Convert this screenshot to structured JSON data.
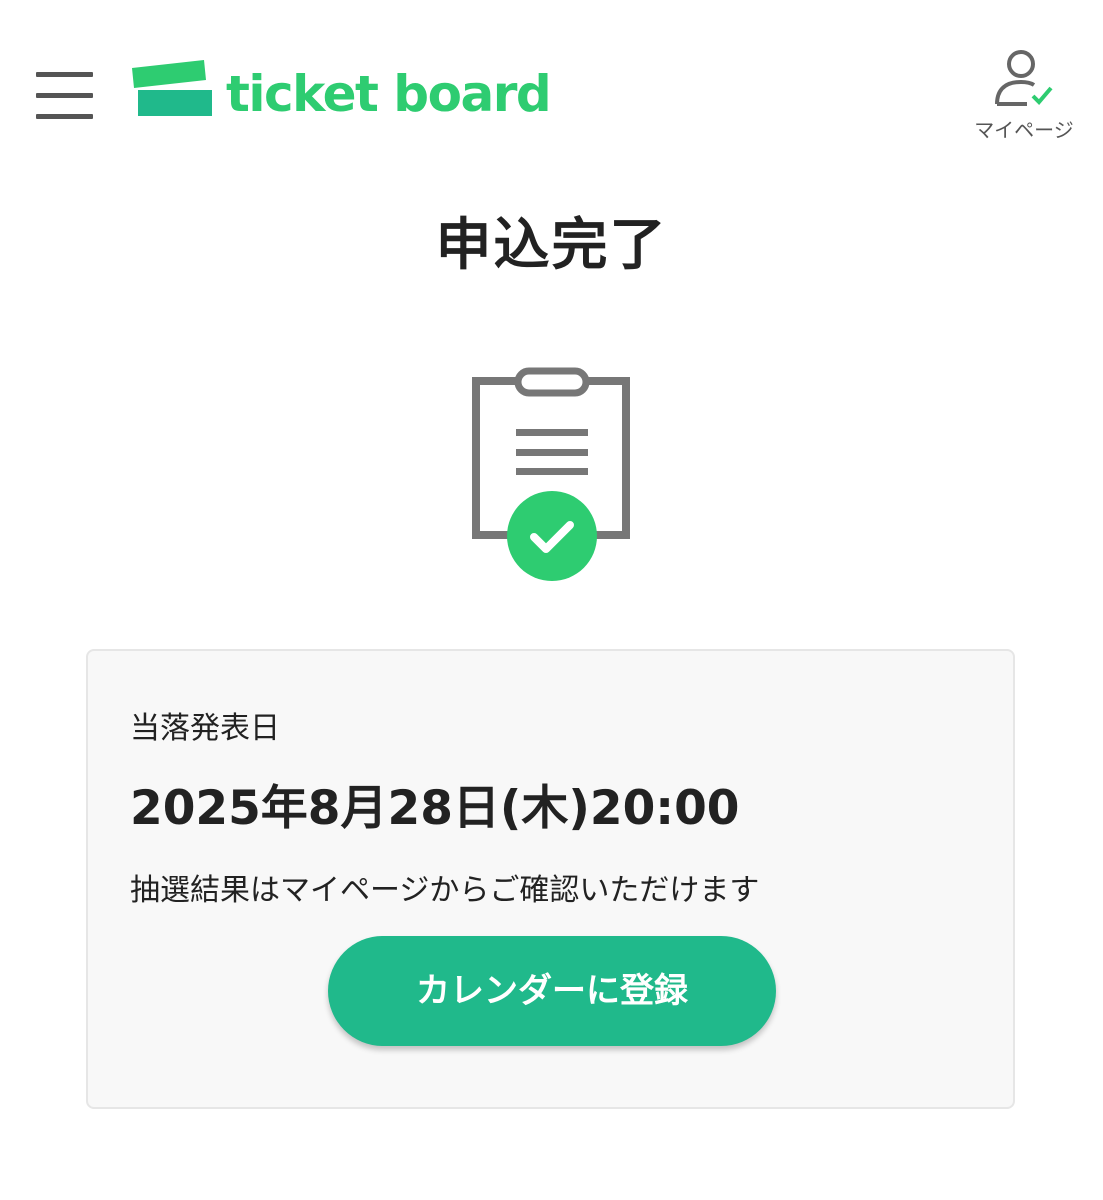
{
  "header": {
    "menu_icon": "hamburger-menu-icon",
    "logo": {
      "text": "ticket board",
      "mark_icon": "ticket-stack-icon",
      "color": "#2ecc71"
    },
    "mypage": {
      "label": "マイページ",
      "icon": "user-check-icon"
    }
  },
  "main": {
    "title": "申込完了",
    "illustration_icon": "clipboard-check-icon",
    "result_card": {
      "label": "当落発表日",
      "date": "2025年8月28日(木)20:00",
      "note": "抽選結果はマイページからご確認いただけます",
      "calendar_button_label": "カレンダーに登録",
      "button_color": "#20b98b"
    }
  },
  "colors": {
    "brand_green": "#2ecc71",
    "button_green": "#20b98b",
    "icon_gray": "#777777"
  }
}
